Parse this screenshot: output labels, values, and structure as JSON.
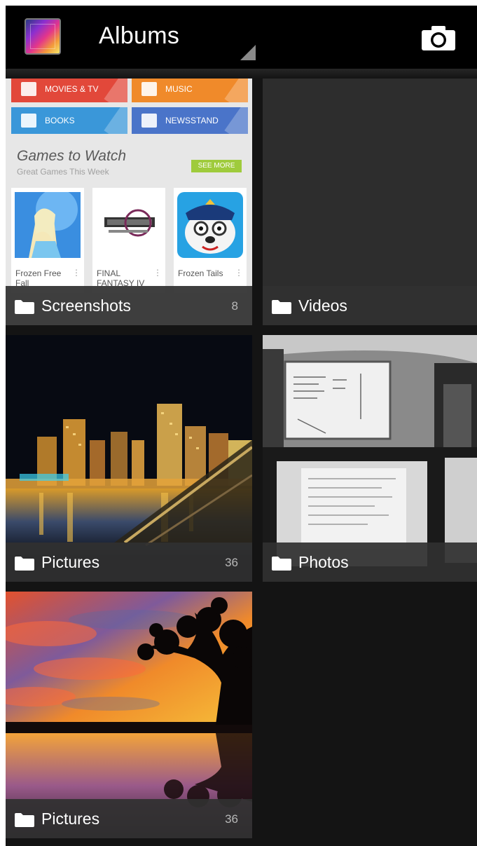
{
  "action_bar": {
    "title": "Albums",
    "app_icon": "gallery-app-icon",
    "camera_icon": "camera-icon"
  },
  "albums": [
    {
      "name": "Screenshots",
      "count": "8"
    },
    {
      "name": "Videos",
      "count": ""
    },
    {
      "name": "Pictures",
      "count": "36"
    },
    {
      "name": "Photos",
      "count": ""
    },
    {
      "name": "Pictures",
      "count": "36"
    }
  ],
  "screenshot_thumb": {
    "categories": [
      {
        "label": "MOVIES & TV",
        "color": "#e2483a"
      },
      {
        "label": "MUSIC",
        "color": "#f08a2a"
      },
      {
        "label": "BOOKS",
        "color": "#3a97d9"
      },
      {
        "label": "NEWSSTAND",
        "color": "#4a74c9"
      }
    ],
    "section_title": "Games to Watch",
    "section_subtitle": "Great Games This Week",
    "see_more": "SEE MORE",
    "games": [
      {
        "name": "Frozen Free Fall"
      },
      {
        "name": "FINAL FANTASY IV"
      },
      {
        "name": "Frozen Tails"
      }
    ]
  },
  "icons": {
    "folder": "folder-icon",
    "camera": "camera-icon"
  }
}
